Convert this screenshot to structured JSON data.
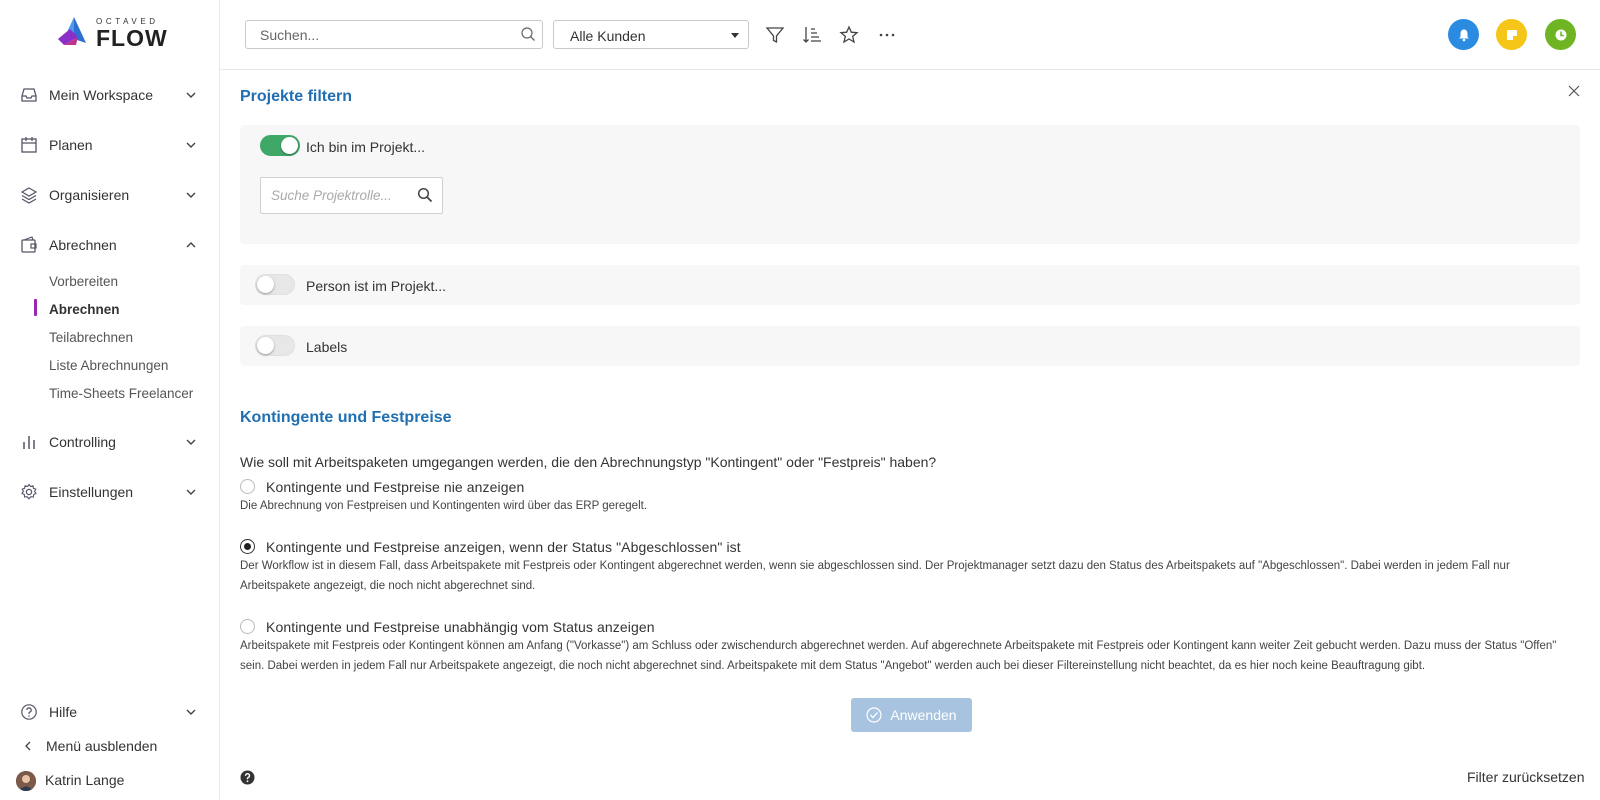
{
  "brand": {
    "small": "OCTAVED",
    "big": "FLOW"
  },
  "colors": {
    "accent": "#1f6fb2",
    "active_bar": "#9b27b0",
    "toggle_on": "#3fa868",
    "bell": "#2b8be0",
    "notes": "#f5c518",
    "timer": "#6fb523",
    "apply_disabled": "#a8c3e0"
  },
  "sidebar": {
    "items": [
      {
        "label": "Mein Workspace",
        "icon": "inbox-icon"
      },
      {
        "label": "Planen",
        "icon": "calendar-icon"
      },
      {
        "label": "Organisieren",
        "icon": "layers-icon"
      },
      {
        "label": "Abrechnen",
        "icon": "wallet-icon"
      },
      {
        "label": "Controlling",
        "icon": "bar-chart-icon"
      },
      {
        "label": "Einstellungen",
        "icon": "gear-icon"
      }
    ],
    "sub_items": [
      "Vorbereiten",
      "Abrechnen",
      "Teilabrechnen",
      "Liste Abrechnungen",
      "Time-Sheets Freelancer"
    ],
    "active_sub": "Abrechnen",
    "help": "Hilfe",
    "hide_menu": "Menü ausblenden",
    "user": "Katrin Lange"
  },
  "topbar": {
    "search_placeholder": "Suchen...",
    "customer_select": "Alle Kunden",
    "tools": [
      "filter-icon",
      "sort-icon",
      "star-icon",
      "more-icon"
    ],
    "status_icons": [
      "bell-icon",
      "note-icon",
      "clock-icon"
    ]
  },
  "filter": {
    "title": "Projekte filtern",
    "in_project": {
      "label": "Ich bin im Projekt...",
      "on": true
    },
    "role_search_placeholder": "Suche Projektrolle...",
    "person_in_project": {
      "label": "Person ist im Projekt...",
      "on": false
    },
    "labels": {
      "label": "Labels",
      "on": false
    }
  },
  "kontingente": {
    "title": "Kontingente und Festpreise",
    "question": "Wie soll mit Arbeitspaketen umgegangen werden, die den Abrechnungstyp \"Kontingent\" oder \"Festpreis\" haben?",
    "options": [
      {
        "label": "Kontingente und Festpreise nie anzeigen",
        "desc": "Die Abrechnung von Festpreisen und Kontingenten wird über das ERP geregelt.",
        "checked": false
      },
      {
        "label": "Kontingente und Festpreise anzeigen, wenn der Status \"Abgeschlossen\" ist",
        "desc": "Der Workflow ist in diesem Fall, dass Arbeitspakete mit Festpreis oder Kontingent abgerechnet werden, wenn sie abgeschlossen sind. Der Projektmanager setzt dazu den Status des Arbeitspakets auf \"Abgeschlossen\". Dabei werden in jedem Fall nur Arbeitspakete angezeigt, die noch nicht abgerechnet sind.",
        "checked": true
      },
      {
        "label": "Kontingente und Festpreise unabhängig vom Status anzeigen",
        "desc": "Arbeitspakete mit Festpreis oder Kontingent können am Anfang (\"Vorkasse\") am Schluss oder zwischendurch abgerechnet werden. Auf abgerechnete Arbeitspakete mit Festpreis oder Kontingent kann weiter Zeit gebucht werden. Dazu muss der Status \"Offen\" sein.  Dabei werden in jedem Fall nur Arbeitspakete angezeigt, die noch nicht abgerechnet sind. Arbeitspakete mit dem Status \"Angebot\" werden  auch bei dieser Filtereinstellung nicht beachtet, da es hier noch keine Beauftragung gibt.",
        "checked": false
      }
    ]
  },
  "actions": {
    "apply": "Anwenden",
    "reset": "Filter zurücksetzen"
  }
}
